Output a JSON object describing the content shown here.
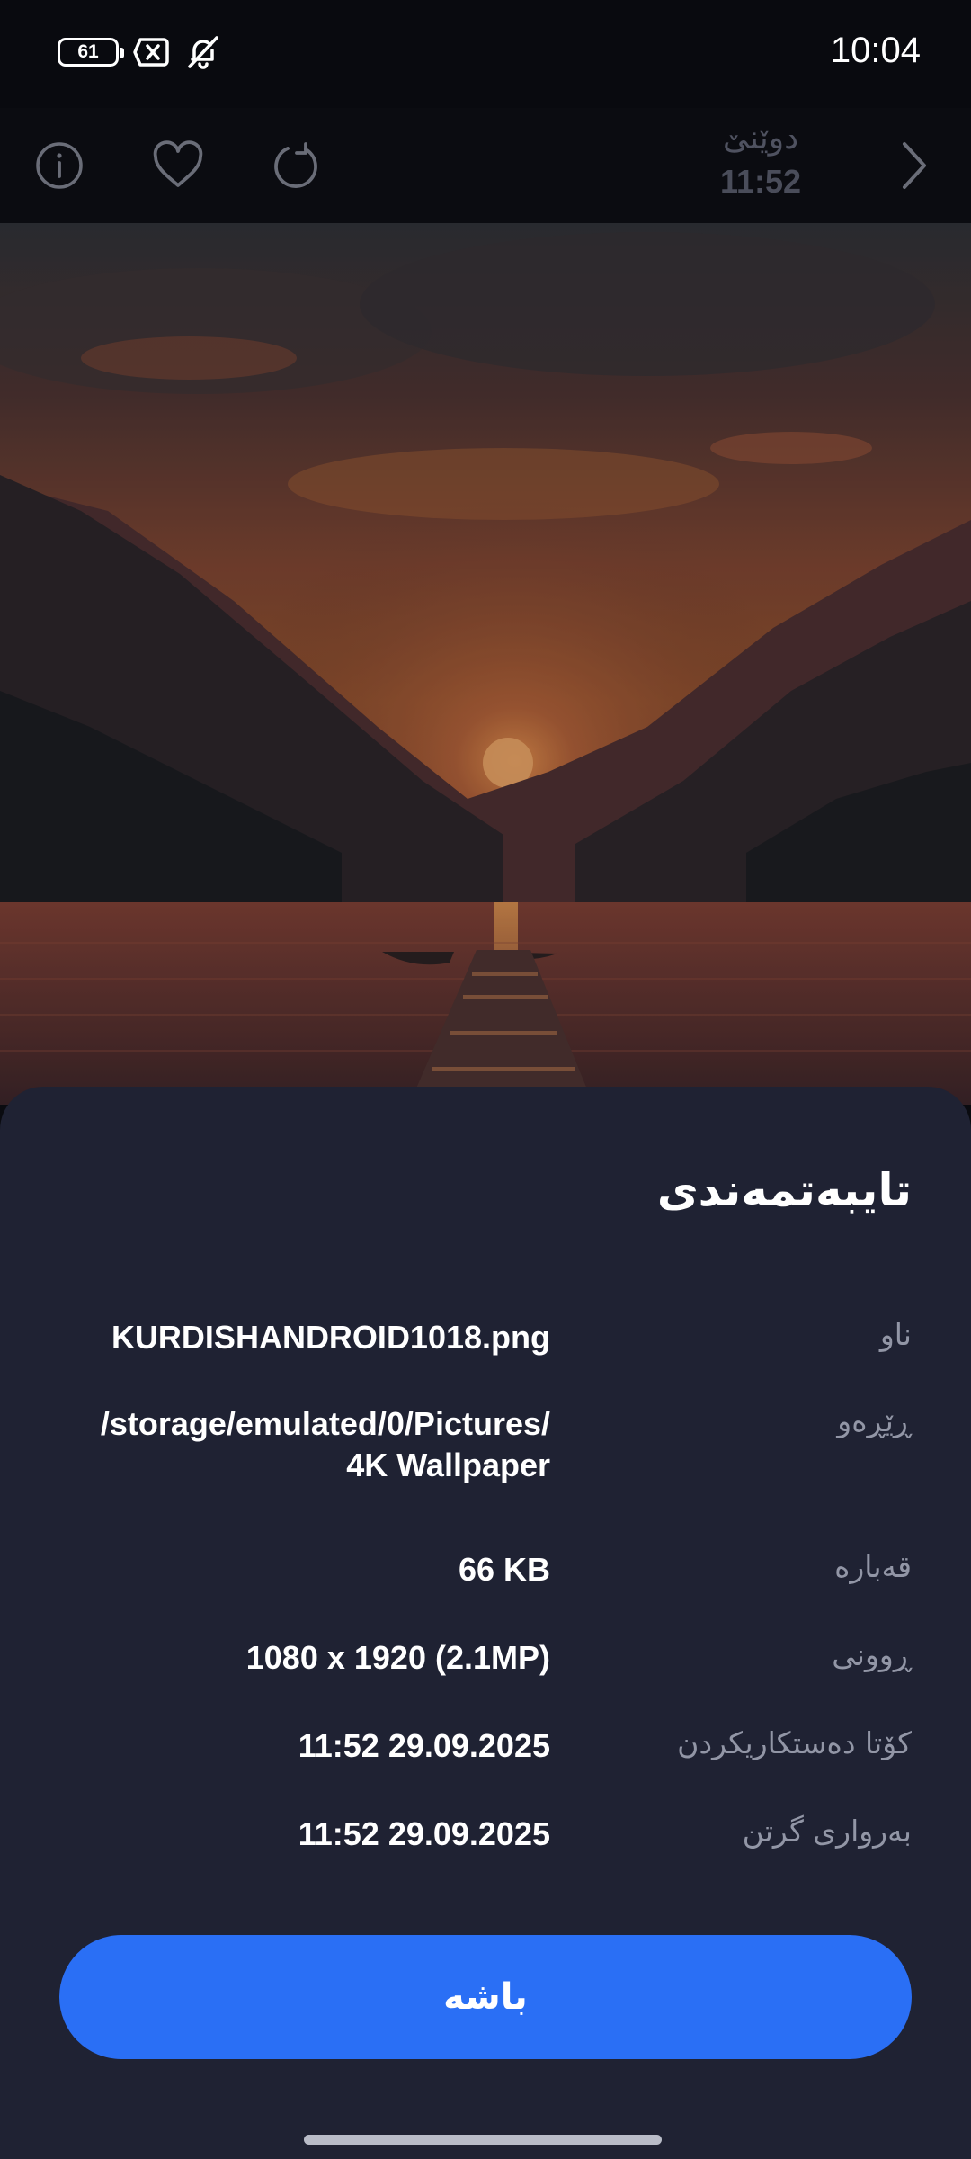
{
  "status_bar": {
    "battery_level": "61",
    "time": "10:04",
    "icons": [
      "battery-icon",
      "no-sim-icon",
      "bell-off-icon"
    ]
  },
  "toolbar": {
    "date_day": "دوێنێ",
    "date_time": "11:52",
    "icons": [
      "info-icon",
      "heart-icon",
      "rotate-icon",
      "chevron-right-icon"
    ]
  },
  "photo": {
    "subject": "sunset-lake-wallpaper"
  },
  "sheet": {
    "title": "تایبەتمەندی",
    "properties": [
      {
        "label": "ناو",
        "value": "KURDISHANDROID1018.png"
      },
      {
        "label": "ڕێڕەو",
        "value": "/storage/emulated/0/Pictures/",
        "value_line2": "4K Wallpaper"
      },
      {
        "label": "قەبارە",
        "value": "66 KB"
      },
      {
        "label": "ڕوونی",
        "value": "1080 x 1920 (2.1MP)"
      },
      {
        "label": "کۆتا دەستکاریکردن",
        "value": "11:52 29.09.2025"
      },
      {
        "label": "بەرواری گرتن",
        "value": "11:52 29.09.2025"
      }
    ],
    "ok_label": "باشە"
  },
  "colors": {
    "background": "#0a0b10",
    "sheet": "#1f2233",
    "accent": "#2a6ff5",
    "label": "#9296a6"
  }
}
